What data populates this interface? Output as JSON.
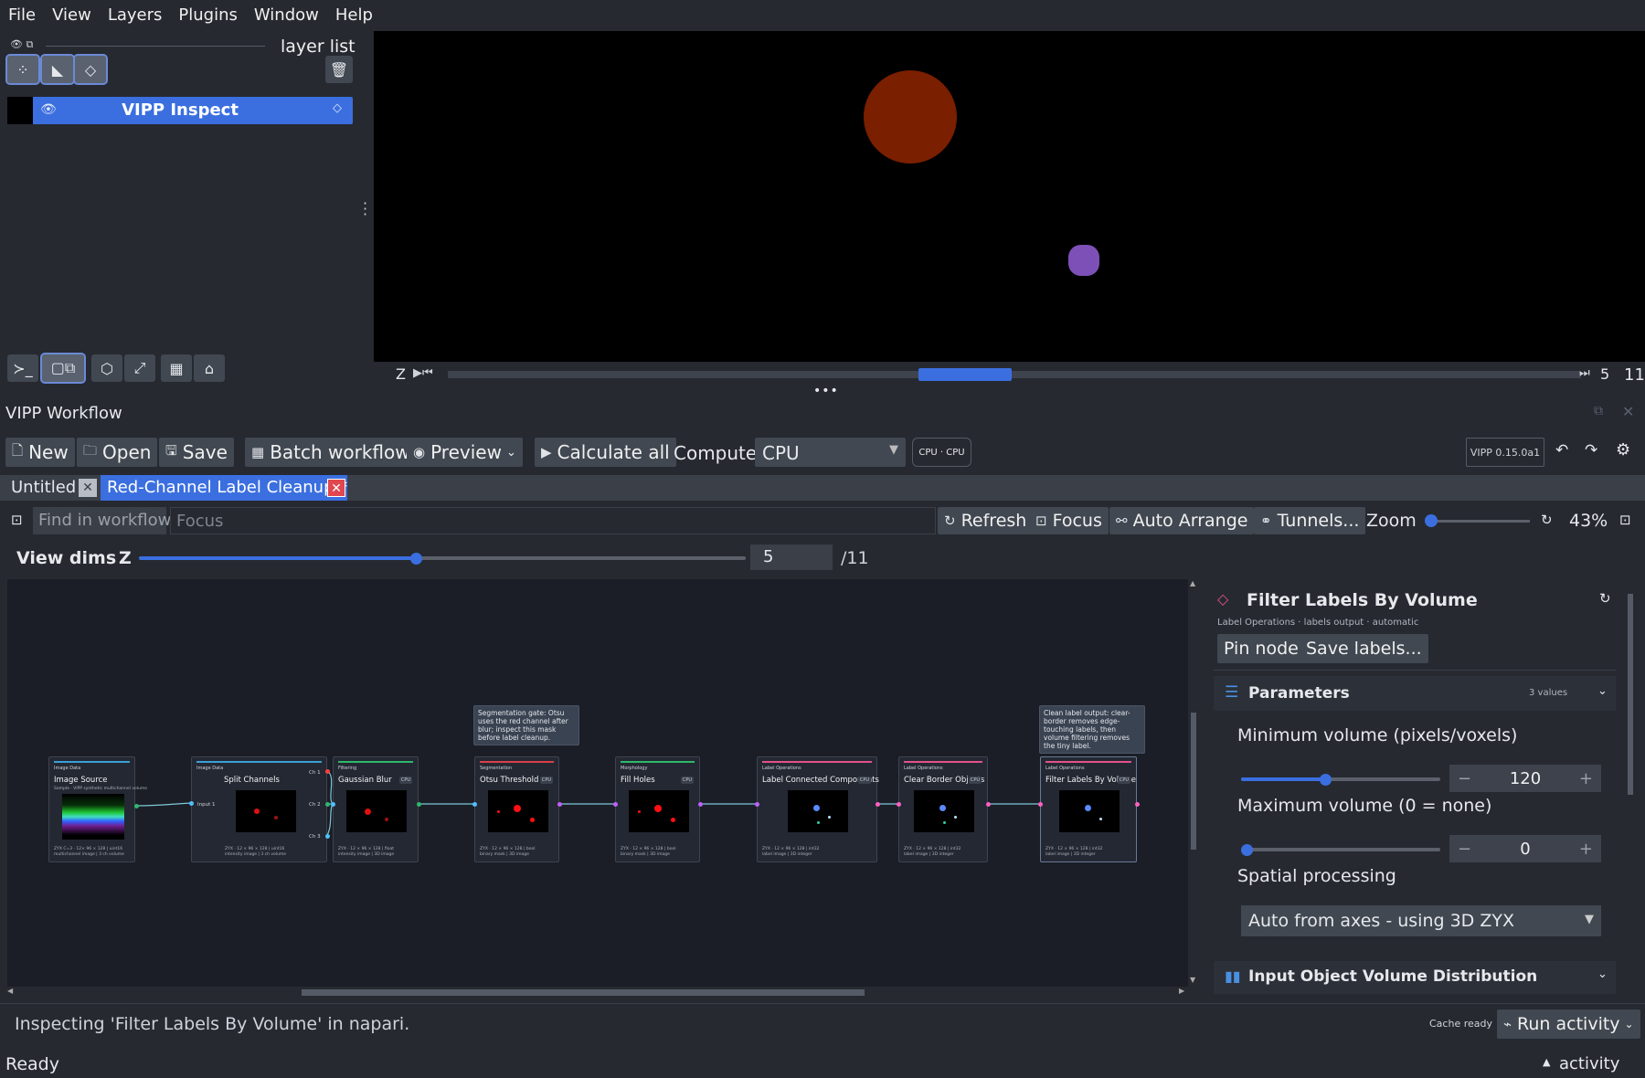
{
  "menu": [
    "File",
    "View",
    "Layers",
    "Plugins",
    "Window",
    "Help"
  ],
  "layer_list": {
    "title": "layer list",
    "layer_name": "VIPP Inspect"
  },
  "viewer": {
    "axis_label": "Z",
    "current": "5",
    "total": "11"
  },
  "workflow": {
    "dock_title": "VIPP Workflow",
    "toolbar": {
      "new": "New",
      "open": "Open",
      "save": "Save",
      "batch": "Batch workflow",
      "preview": "Preview",
      "calc_all": "Calculate all",
      "compute_label": "Compute",
      "compute_value": "CPU",
      "cpu_badge": "CPU · CPU",
      "version": "VIPP 0.15.0a1"
    },
    "tabs": [
      {
        "label": "Untitled"
      },
      {
        "label": "Red-Channel Label Cleanup *"
      }
    ],
    "search": {
      "placeholder": "Find in workflow",
      "focus": "Focus"
    },
    "actions": {
      "refresh": "Refresh",
      "focus": "Focus",
      "auto_arrange": "Auto Arrange",
      "tunnels": "Tunnels...",
      "zoom_label": "Zoom",
      "zoom_value": "43%"
    },
    "view_dims": {
      "label": "View dims",
      "axis": "Z",
      "value": "5",
      "total": "/11"
    },
    "nodes": [
      {
        "cat": "Image Data",
        "title": "Image Source",
        "sub": "Sample · VIPP synthetic multichannel volume",
        "meta1": "ZYX C=3 · 12× 96 × 128 | uint16",
        "meta2": "multichannel image | 3 ch volume",
        "color": "#3aa0d8",
        "badge": ""
      },
      {
        "cat": "Image Data",
        "title": "Split Channels",
        "meta1": "ZYX · 12 × 96 × 128 | uint16",
        "meta2": "intensity image | 3 ch volume",
        "color": "#3aa0d8",
        "badge": ""
      },
      {
        "cat": "Filtering",
        "title": "Gaussian Blur",
        "meta1": "ZYX · 12 × 96 × 128 | float",
        "meta2": "intensity image | 3D image",
        "color": "#2fb86b",
        "badge": "CPU"
      },
      {
        "cat": "Segmentation",
        "title": "Otsu Threshold",
        "meta1": "ZYX · 12 × 96 × 128 | bool",
        "meta2": "binary mask | 3D image",
        "color": "#d8404a",
        "badge": "CPU"
      },
      {
        "cat": "Morphology",
        "title": "Fill Holes",
        "meta1": "ZYX · 12 × 96 × 128 | bool",
        "meta2": "binary mask | 3D image",
        "color": "#2fb86b",
        "badge": "CPU"
      },
      {
        "cat": "Label Operations",
        "title": "Label Connected Components",
        "meta1": "ZYX · 12 × 96 × 128 | int32",
        "meta2": "label image | 3D integer",
        "color": "#e0528a",
        "badge": "CPU"
      },
      {
        "cat": "Label Operations",
        "title": "Clear Border Objects",
        "meta1": "ZYX · 12 × 96 × 128 | int32",
        "meta2": "label image | 3D integer",
        "color": "#e0528a",
        "badge": "CPU"
      },
      {
        "cat": "Label Operations",
        "title": "Filter Labels By Volume",
        "meta1": "ZYX · 12 × 96 × 128 | int32",
        "meta2": "label image | 3D integer",
        "color": "#e0528a",
        "badge": "CPU"
      }
    ],
    "ports": {
      "input1": "Input 1",
      "ch1": "Ch 1",
      "ch2": "Ch 2",
      "ch3": "Ch 3"
    },
    "notes": [
      {
        "text": "Segmentation gate: Otsu uses the red channel after blur; inspect this mask before label cleanup."
      },
      {
        "text": "Clean label output: clear-border removes edge-touching labels, then volume filtering removes the tiny label."
      }
    ],
    "inspector": {
      "title": "Filter Labels By Volume",
      "subtitle": "Label Operations · labels output · automatic",
      "pin": "Pin node",
      "save_labels": "Save labels...",
      "params_title": "Parameters",
      "params_count": "3 values",
      "min_label": "Minimum volume (pixels/voxels)",
      "min_value": "120",
      "min_frac": 0.42,
      "max_label": "Maximum volume (0 = none)",
      "max_value": "0",
      "max_frac": 0.0,
      "spatial_label": "Spatial processing",
      "spatial_value": "Auto from axes - using 3D ZYX",
      "dist_title": "Input Object Volume Distribution"
    },
    "status": {
      "message": "Inspecting 'Filter Labels By Volume' in napari.",
      "cache": "Cache ready",
      "run_activity": "Run activity"
    }
  },
  "app_status": {
    "ready": "Ready",
    "activity": "activity"
  }
}
